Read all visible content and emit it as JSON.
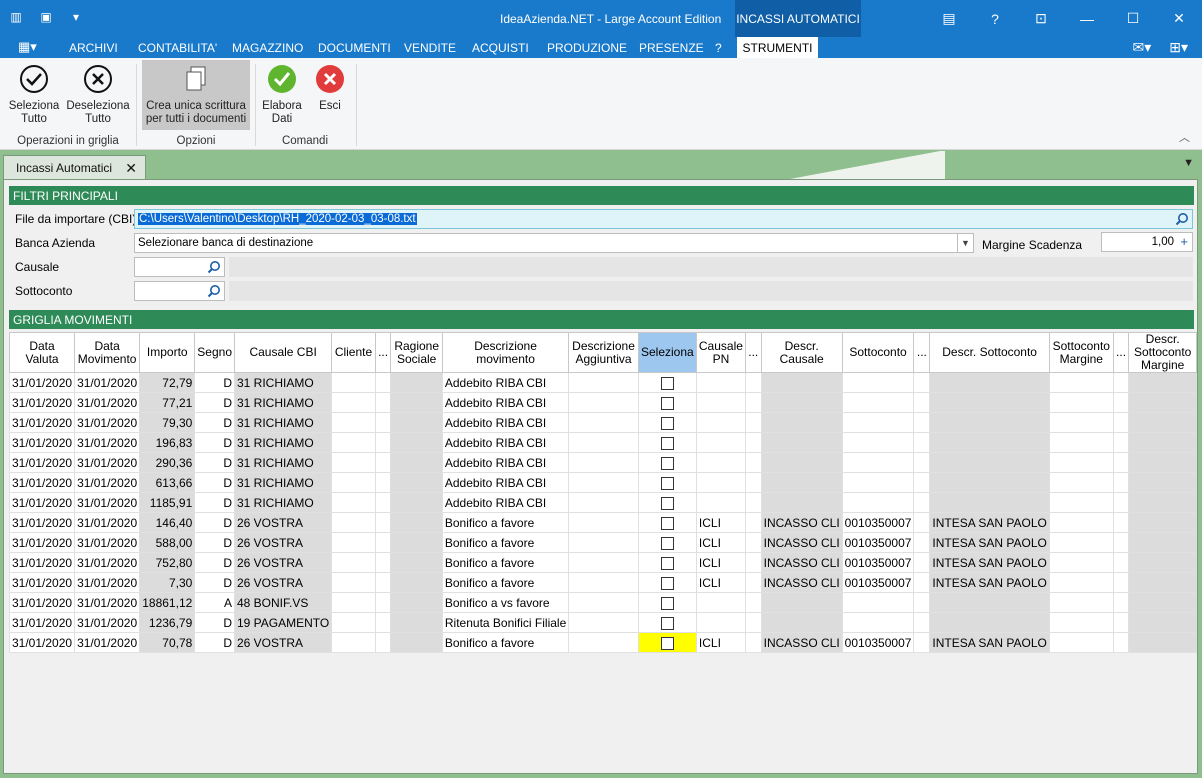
{
  "window": {
    "title": "IdeaAzienda.NET - Large Account Edition",
    "context_tab": "INCASSI AUTOMATICI"
  },
  "menu": [
    "ARCHIVI",
    "CONTABILITA'",
    "MAGAZZINO",
    "DOCUMENTI",
    "VENDITE",
    "ACQUISTI",
    "PRODUZIONE",
    "PRESENZE",
    "?",
    "STRUMENTI"
  ],
  "ribbon": {
    "seleziona": "Seleziona\nTutto",
    "deseleziona": "Deseleziona\nTutto",
    "crea": "Crea unica scrittura\nper tutti i documenti",
    "elabora": "Elabora\nDati",
    "esci": "Esci",
    "group1": "Operazioni in griglia",
    "group2": "Opzioni",
    "group3": "Comandi"
  },
  "doc_tab": "Incassi Automatici",
  "filters": {
    "header": "FILTRI PRINCIPALI",
    "file_label": "File da importare (CBI)",
    "file_value": "C:\\Users\\Valentino\\Desktop\\RH_2020-02-03_03-08.txt",
    "banca_label": "Banca Azienda",
    "banca_value": "Selezionare banca di destinazione",
    "margine_label": "Margine Scadenza",
    "margine_value": "1,00",
    "causale_label": "Causale",
    "sottoconto_label": "Sottoconto"
  },
  "grid": {
    "header": "GRIGLIA MOVIMENTI",
    "columns": [
      "Data Valuta",
      "Data Movimento",
      "Importo",
      "Segno",
      "Causale CBI",
      "Cliente",
      "...",
      "Ragione Sociale",
      "Descrizione movimento",
      "Descrizione Aggiuntiva",
      "Seleziona",
      "Causale PN",
      "...",
      "Descr. Causale",
      "Sottoconto",
      "...",
      "Descr. Sottoconto",
      "Sottoconto Margine",
      "...",
      "Descr. Sottoconto Margine"
    ],
    "rows": [
      {
        "dv": "31/01/2020",
        "dm": "31/01/2020",
        "imp": "72,79",
        "seg": "D",
        "cbi": "31 RICHIAMO",
        "desc": "Addebito RIBA CBI",
        "cpn": "",
        "dcaus": "",
        "sotto": "",
        "dsotto": ""
      },
      {
        "dv": "31/01/2020",
        "dm": "31/01/2020",
        "imp": "77,21",
        "seg": "D",
        "cbi": "31 RICHIAMO",
        "desc": "Addebito RIBA CBI",
        "cpn": "",
        "dcaus": "",
        "sotto": "",
        "dsotto": ""
      },
      {
        "dv": "31/01/2020",
        "dm": "31/01/2020",
        "imp": "79,30",
        "seg": "D",
        "cbi": "31 RICHIAMO",
        "desc": "Addebito RIBA CBI",
        "cpn": "",
        "dcaus": "",
        "sotto": "",
        "dsotto": ""
      },
      {
        "dv": "31/01/2020",
        "dm": "31/01/2020",
        "imp": "196,83",
        "seg": "D",
        "cbi": "31 RICHIAMO",
        "desc": "Addebito RIBA CBI",
        "cpn": "",
        "dcaus": "",
        "sotto": "",
        "dsotto": ""
      },
      {
        "dv": "31/01/2020",
        "dm": "31/01/2020",
        "imp": "290,36",
        "seg": "D",
        "cbi": "31 RICHIAMO",
        "desc": "Addebito RIBA CBI",
        "cpn": "",
        "dcaus": "",
        "sotto": "",
        "dsotto": ""
      },
      {
        "dv": "31/01/2020",
        "dm": "31/01/2020",
        "imp": "613,66",
        "seg": "D",
        "cbi": "31 RICHIAMO",
        "desc": "Addebito RIBA CBI",
        "cpn": "",
        "dcaus": "",
        "sotto": "",
        "dsotto": ""
      },
      {
        "dv": "31/01/2020",
        "dm": "31/01/2020",
        "imp": "1185,91",
        "seg": "D",
        "cbi": "31 RICHIAMO",
        "desc": "Addebito RIBA CBI",
        "cpn": "",
        "dcaus": "",
        "sotto": "",
        "dsotto": ""
      },
      {
        "dv": "31/01/2020",
        "dm": "31/01/2020",
        "imp": "146,40",
        "seg": "D",
        "cbi": "26 VOSTRA",
        "desc": "Bonifico a favore",
        "cpn": "ICLI",
        "dcaus": "INCASSO CLI",
        "sotto": "0010350007",
        "dsotto": "INTESA SAN PAOLO"
      },
      {
        "dv": "31/01/2020",
        "dm": "31/01/2020",
        "imp": "588,00",
        "seg": "D",
        "cbi": "26 VOSTRA",
        "desc": "Bonifico a favore",
        "cpn": "ICLI",
        "dcaus": "INCASSO CLI",
        "sotto": "0010350007",
        "dsotto": "INTESA SAN PAOLO"
      },
      {
        "dv": "31/01/2020",
        "dm": "31/01/2020",
        "imp": "752,80",
        "seg": "D",
        "cbi": "26 VOSTRA",
        "desc": "Bonifico a favore",
        "cpn": "ICLI",
        "dcaus": "INCASSO CLI",
        "sotto": "0010350007",
        "dsotto": "INTESA SAN PAOLO"
      },
      {
        "dv": "31/01/2020",
        "dm": "31/01/2020",
        "imp": "7,30",
        "seg": "D",
        "cbi": "26 VOSTRA",
        "desc": "Bonifico a favore",
        "cpn": "ICLI",
        "dcaus": "INCASSO CLI",
        "sotto": "0010350007",
        "dsotto": "INTESA SAN PAOLO"
      },
      {
        "dv": "31/01/2020",
        "dm": "31/01/2020",
        "imp": "18861,12",
        "seg": "A",
        "cbi": "48 BONIF.VS",
        "desc": "Bonifico a vs favore",
        "cpn": "",
        "dcaus": "",
        "sotto": "",
        "dsotto": ""
      },
      {
        "dv": "31/01/2020",
        "dm": "31/01/2020",
        "imp": "1236,79",
        "seg": "D",
        "cbi": "19 PAGAMENTO",
        "desc": "Ritenuta Bonifici Filiale",
        "cpn": "",
        "dcaus": "",
        "sotto": "",
        "dsotto": ""
      },
      {
        "dv": "31/01/2020",
        "dm": "31/01/2020",
        "imp": "70,78",
        "seg": "D",
        "cbi": "26 VOSTRA",
        "desc": "Bonifico a favore",
        "cpn": "ICLI",
        "dcaus": "INCASSO CLI",
        "sotto": "0010350007",
        "dsotto": "INTESA SAN PAOLO",
        "highlight": true
      }
    ]
  },
  "colors": {
    "title_bar": "#1979ca",
    "section": "#2e8b57",
    "highlight": "#ffff00",
    "selected_header": "#9ec7ef"
  }
}
